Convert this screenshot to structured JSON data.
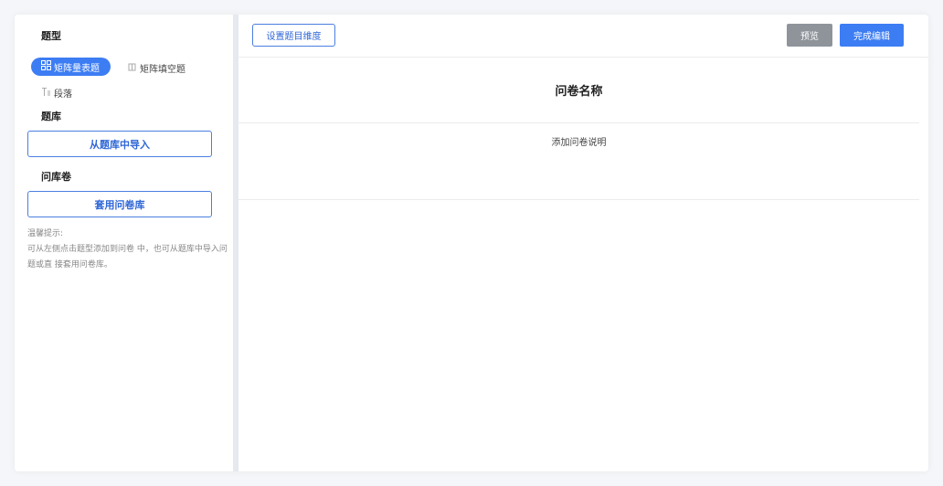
{
  "sidebar": {
    "qtype_title": "题型",
    "qtypes": [
      {
        "label": "矩阵量表题",
        "icon": "grid-icon",
        "active": true
      },
      {
        "label": "矩阵填空题",
        "icon": "fill-blank-icon",
        "active": false
      },
      {
        "label": "段落",
        "icon": "paragraph-icon",
        "active": false
      }
    ],
    "bank_title": "题库",
    "import_button": "从题库中导入",
    "survey_bank_title": "问库卷",
    "apply_button": "套用问卷库",
    "tip_title": "温馨提示:",
    "tip_text": "可从左侧点击题型添加到问卷 中，也可从题库中导入问题或直 接套用问卷库。"
  },
  "toolbar": {
    "dimension_button": "设置题目维度",
    "preview_button": "预览",
    "done_button": "完成编辑"
  },
  "survey": {
    "name": "问卷名称",
    "description_placeholder": "添加问卷说明"
  },
  "colors": {
    "accent": "#3d7df3",
    "preview_gray": "#8f949b"
  }
}
